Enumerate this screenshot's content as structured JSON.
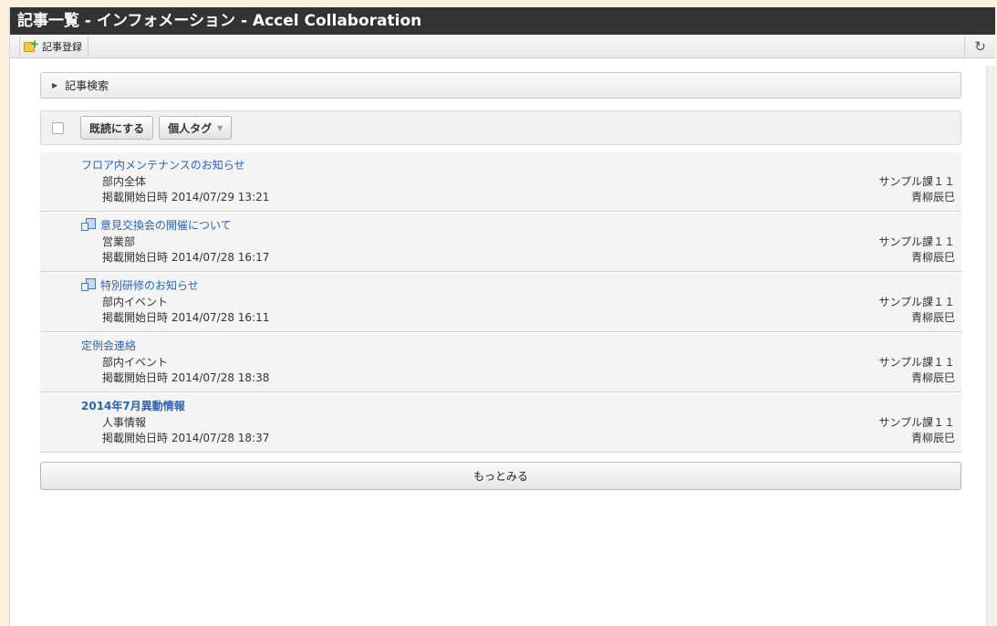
{
  "window": {
    "title": "記事一覧 - インフォメーション - Accel Collaboration"
  },
  "toolbar": {
    "add_label": "記事登録",
    "add_icon": "add-article-icon",
    "reload_icon": "reload-icon"
  },
  "search": {
    "label": "記事検索"
  },
  "actions": {
    "mark_read_label": "既読にする",
    "tag_label": "個人タグ"
  },
  "items": [
    {
      "title": "フロア内メンテナンスのお知らせ",
      "category": "部内全体",
      "date": "掲載開始日時  2014/07/29 13:21",
      "group": "サンプル課１１",
      "author": "青柳辰巳",
      "attachment": false,
      "bold": false
    },
    {
      "title": "意見交換会の開催について",
      "category": "営業部",
      "date": "掲載開始日時  2014/07/28 16:17",
      "group": "サンプル課１１",
      "author": "青柳辰巳",
      "attachment": true,
      "bold": false
    },
    {
      "title": "特別研修のお知らせ",
      "category": "部内イベント",
      "date": "掲載開始日時  2014/07/28 16:11",
      "group": "サンプル課１１",
      "author": "青柳辰巳",
      "attachment": true,
      "bold": false
    },
    {
      "title": "定例会連絡",
      "category": "部内イベント",
      "date": "掲載開始日時  2014/07/28 18:38",
      "group": "サンプル課１１",
      "author": "青柳辰巳",
      "attachment": false,
      "bold": false
    },
    {
      "title": "2014年7月異動情報",
      "category": "人事情報",
      "date": "掲載開始日時  2014/07/28 18:37",
      "group": "サンプル課１１",
      "author": "青柳辰巳",
      "attachment": false,
      "bold": true
    }
  ],
  "more": {
    "label": "もっとみる"
  },
  "colors": {
    "link": "#2a64b9",
    "titlebar": "#333333",
    "background": "#fdf0dc"
  }
}
